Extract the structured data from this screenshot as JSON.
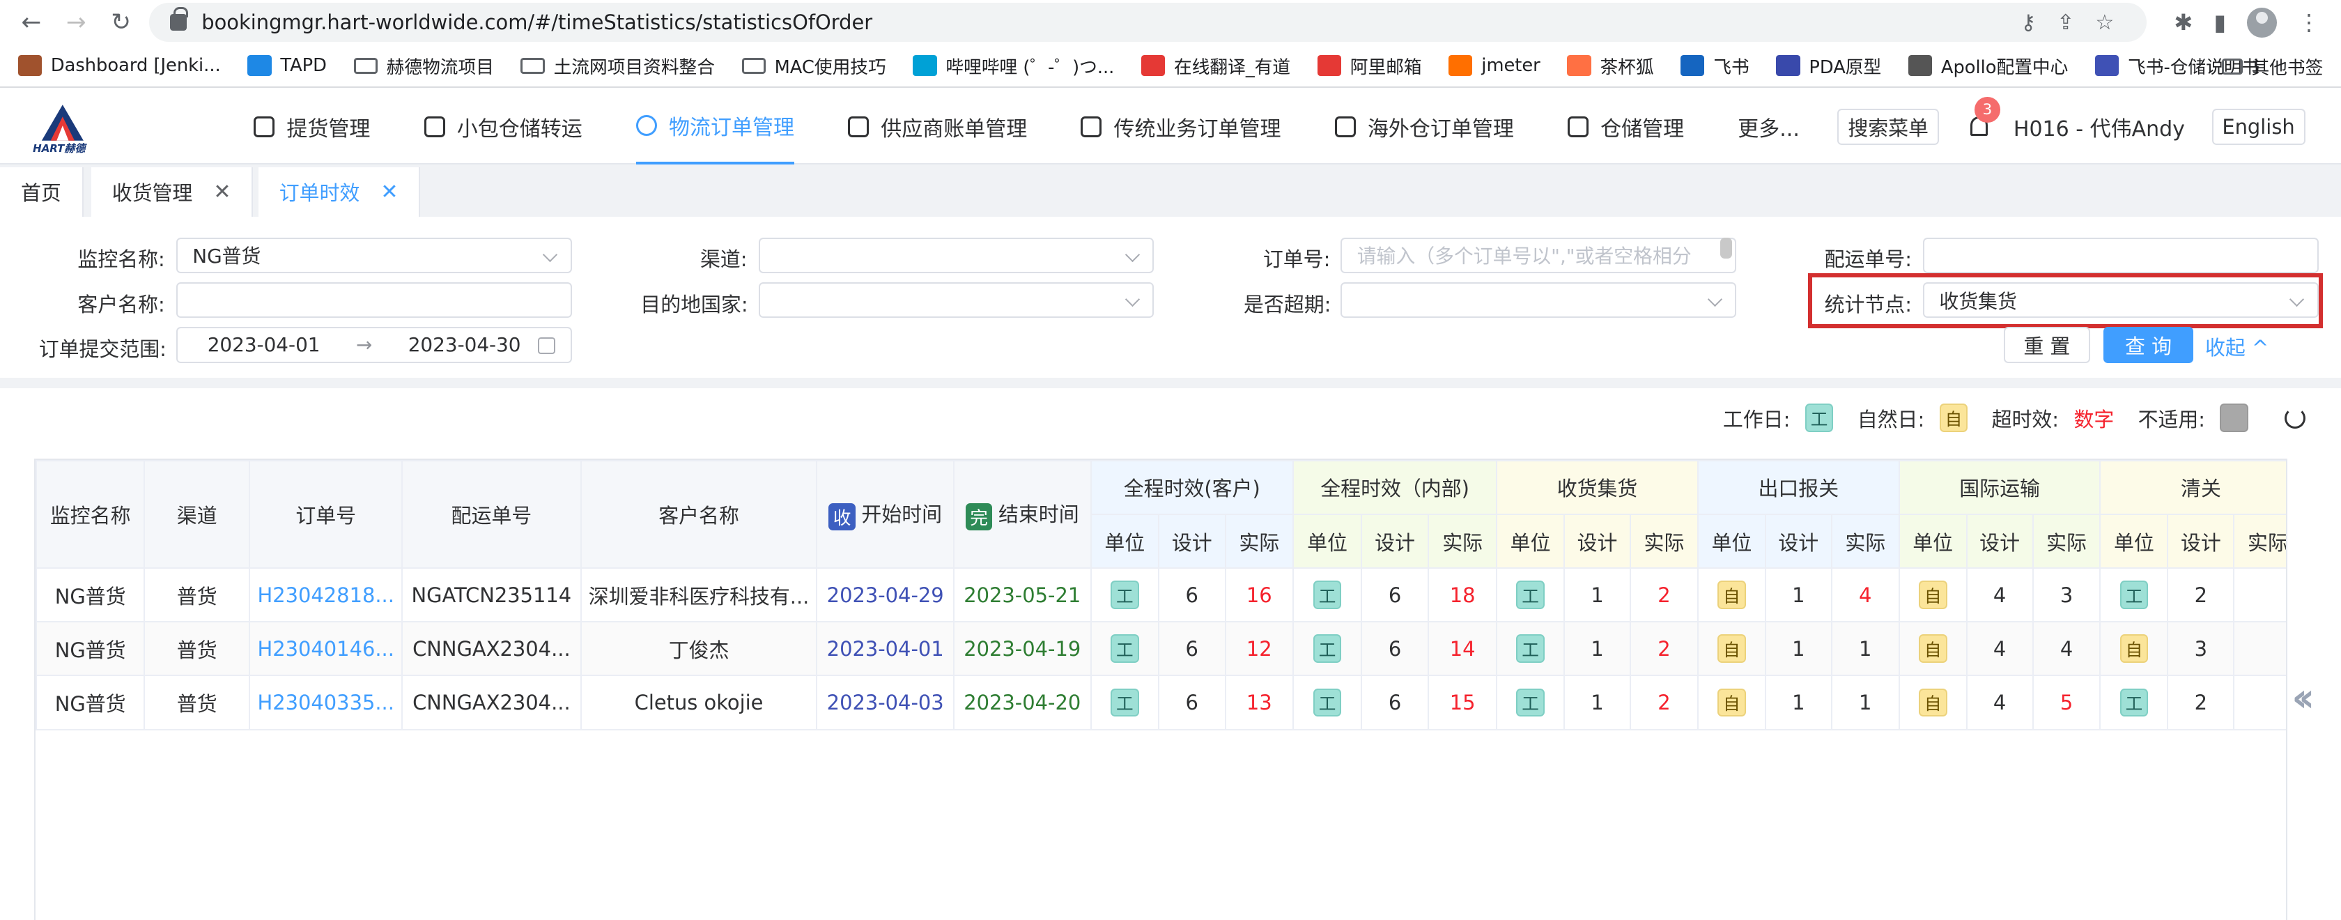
{
  "browser": {
    "url": "bookingmgr.hart-worldwide.com/#/timeStatistics/statisticsOfOrder",
    "bookmarks": [
      "Dashboard [Jenki...",
      "TAPD",
      "赫德物流项目",
      "土流网项目资料整合",
      "MAC使用技巧",
      "哔哩哔哩 (゜-゜)つ...",
      "在线翻译_有道",
      "阿里邮箱",
      "jmeter",
      "茶杯狐",
      "飞书",
      "PDA原型",
      "Apollo配置中心",
      "飞书-仓储说明书"
    ],
    "bookmark_colors": [
      "#a0522d",
      "#1e88e5",
      "",
      "",
      "",
      "#00a1d6",
      "#e53935",
      "#e53935",
      "#ff6f00",
      "#ff7043",
      "#1565c0",
      "#3949ab",
      "#555555",
      "#3f51b5"
    ],
    "other_bookmarks": "其他书签"
  },
  "app": {
    "logo_text": "HART赫德",
    "nav": [
      "提货管理",
      "小包仓储转运",
      "物流订单管理",
      "供应商账单管理",
      "传统业务订单管理",
      "海外仓订单管理",
      "仓储管理",
      "更多..."
    ],
    "active_nav_index": 2,
    "search_menu": "搜索菜单",
    "notification_count": "3",
    "user": "H016 - 代伟Andy",
    "language": "English"
  },
  "tabs": [
    {
      "label": "首页",
      "closable": false
    },
    {
      "label": "收货管理",
      "closable": true
    },
    {
      "label": "订单时效",
      "closable": true,
      "active": true
    }
  ],
  "filters": {
    "monitor_name": {
      "label": "监控名称:",
      "value": "NG普货"
    },
    "channel": {
      "label": "渠道:",
      "value": ""
    },
    "order_no": {
      "label": "订单号:",
      "placeholder": "请输入（多个订单号以\",\"或者空格相分"
    },
    "delivery_no": {
      "label": "配运单号:",
      "value": ""
    },
    "customer_name": {
      "label": "客户名称:",
      "value": ""
    },
    "dest_country": {
      "label": "目的地国家:",
      "value": ""
    },
    "overdue": {
      "label": "是否超期:",
      "value": ""
    },
    "stat_node": {
      "label": "统计节点:",
      "value": "收货集货"
    },
    "submit_range": {
      "label": "订单提交范围:",
      "start": "2023-04-01",
      "end": "2023-04-30",
      "arrow": "→"
    },
    "reset": "重 置",
    "query": "查 询",
    "collapse": "收起 ^"
  },
  "legend": {
    "workday": "工作日:",
    "workday_tag": "工",
    "natural": "自然日:",
    "natural_tag": "自",
    "overtime": "超时效:",
    "overtime_value": "数字",
    "not_applicable": "不适用:"
  },
  "table": {
    "fixed_headers": [
      "监控名称",
      "渠道",
      "订单号",
      "配运单号",
      "客户名称"
    ],
    "start_tag": "收",
    "start_label": "开始时间",
    "end_tag": "完",
    "end_label": "结束时间",
    "groups": [
      "全程时效(客户)",
      "全程时效（内部)",
      "收货集货",
      "出口报关",
      "国际运输",
      "清关"
    ],
    "sub_headers": [
      "单位",
      "设计",
      "实际"
    ],
    "rows": [
      {
        "monitor": "NG普货",
        "channel": "普货",
        "order": "H23042818...",
        "delivery": "NGATCN235114",
        "customer": "深圳爱非科医疗科技有...",
        "start": "2023-04-29",
        "end": "2023-05-21",
        "cells": [
          [
            "工",
            "6",
            "16",
            true
          ],
          [
            "工",
            "6",
            "18",
            true
          ],
          [
            "工",
            "1",
            "2",
            true
          ],
          [
            "自",
            "1",
            "4",
            true
          ],
          [
            "自",
            "4",
            "3",
            false
          ],
          [
            "工",
            "2",
            "",
            false
          ]
        ]
      },
      {
        "monitor": "NG普货",
        "channel": "普货",
        "order": "H23040146...",
        "delivery": "CNNGAX2304...",
        "customer": "丁俊杰",
        "start": "2023-04-01",
        "end": "2023-04-19",
        "cells": [
          [
            "工",
            "6",
            "12",
            true
          ],
          [
            "工",
            "6",
            "14",
            true
          ],
          [
            "工",
            "1",
            "2",
            true
          ],
          [
            "自",
            "1",
            "1",
            false
          ],
          [
            "自",
            "4",
            "4",
            false
          ],
          [
            "自",
            "3",
            "",
            false
          ]
        ]
      },
      {
        "monitor": "NG普货",
        "channel": "普货",
        "order": "H23040335...",
        "delivery": "CNNGAX2304...",
        "customer": "Cletus okojie",
        "start": "2023-04-03",
        "end": "2023-04-20",
        "cells": [
          [
            "工",
            "6",
            "13",
            true
          ],
          [
            "工",
            "6",
            "15",
            true
          ],
          [
            "工",
            "1",
            "2",
            true
          ],
          [
            "自",
            "1",
            "1",
            false
          ],
          [
            "自",
            "4",
            "5",
            true
          ],
          [
            "工",
            "2",
            "",
            false
          ]
        ]
      }
    ]
  }
}
